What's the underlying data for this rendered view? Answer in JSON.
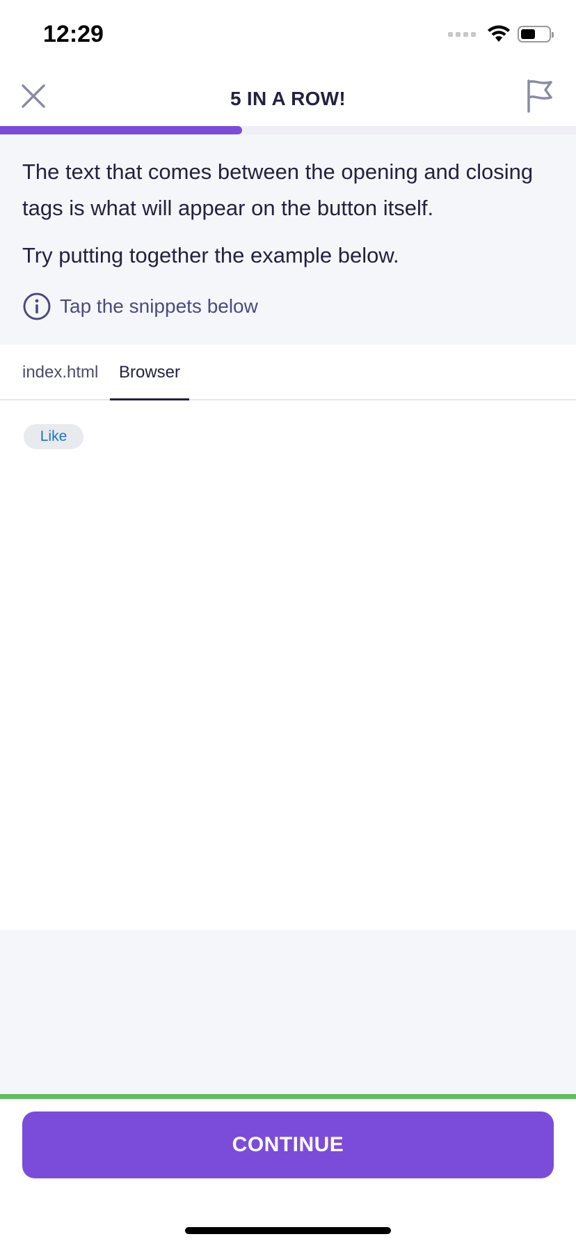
{
  "status_bar": {
    "time": "12:29"
  },
  "header": {
    "title": "5 IN A ROW!",
    "progress_percent": 42
  },
  "lesson": {
    "paragraph1": "The text that comes between the opening and closing tags is what will appear on the button itself.",
    "paragraph2": "Try putting together the example below.",
    "hint": "Tap the snippets below"
  },
  "tabs": [
    {
      "label": "index.html",
      "active": false
    },
    {
      "label": "Browser",
      "active": true
    }
  ],
  "browser": {
    "like_button": "Like"
  },
  "footer": {
    "continue_label": "CONTINUE"
  },
  "colors": {
    "accent": "#7b4cd9",
    "success": "#5fbf5a",
    "link": "#1a73c8"
  }
}
